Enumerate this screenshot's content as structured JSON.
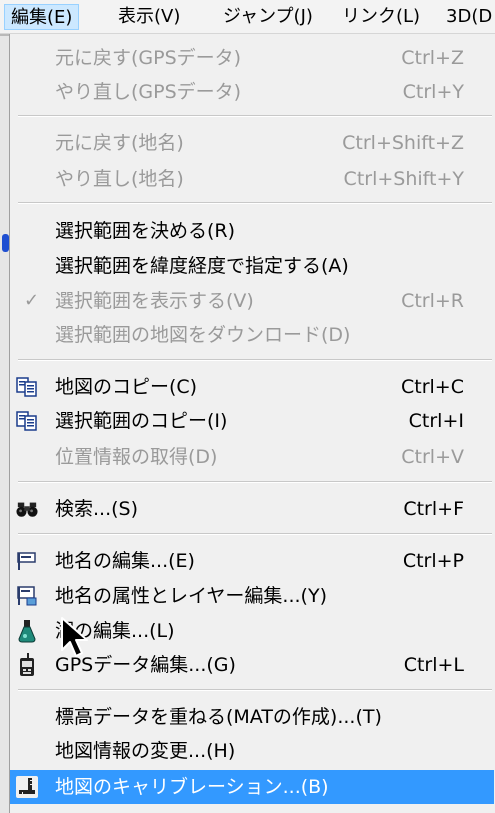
{
  "menubar": {
    "items": [
      "編集(E)",
      "表示(V)",
      "ジャンプ(J)",
      "リンク(L)",
      "3D(D"
    ]
  },
  "menu": {
    "undo_gps": {
      "label": "元に戻す(GPSデータ)",
      "shortcut": "Ctrl+Z"
    },
    "redo_gps": {
      "label": "やり直し(GPSデータ)",
      "shortcut": "Ctrl+Y"
    },
    "undo_place": {
      "label": "元に戻す(地名)",
      "shortcut": "Ctrl+Shift+Z"
    },
    "redo_place": {
      "label": "やり直し(地名)",
      "shortcut": "Ctrl+Shift+Y"
    },
    "select_range": {
      "label": "選択範囲を決める(R)"
    },
    "select_latlon": {
      "label": "選択範囲を緯度経度で指定する(A)"
    },
    "show_range": {
      "label": "選択範囲を表示する(V)",
      "shortcut": "Ctrl+R",
      "check": "✓"
    },
    "download_range": {
      "label": "選択範囲の地図をダウンロード(D)"
    },
    "copy_map": {
      "label": "地図のコピー(C)",
      "shortcut": "Ctrl+C"
    },
    "copy_range": {
      "label": "選択範囲のコピー(I)",
      "shortcut": "Ctrl+I"
    },
    "get_position": {
      "label": "位置情報の取得(D)",
      "shortcut": "Ctrl+V"
    },
    "search": {
      "label": "検索...(S)",
      "shortcut": "Ctrl+F"
    },
    "edit_place": {
      "label": "地名の編集...(E)",
      "shortcut": "Ctrl+P"
    },
    "edit_attr_layer": {
      "label": "地名の属性とレイヤー編集...(Y)"
    },
    "edit_water": {
      "label": "湖の編集...(L)"
    },
    "edit_gps": {
      "label": "GPSデータ編集...(G)",
      "shortcut": "Ctrl+L"
    },
    "overlay_elev": {
      "label": "標高データを重ねる(MATの作成)...(T)"
    },
    "change_map_info": {
      "label": "地図情報の変更...(H)"
    },
    "calibration": {
      "label": "地図のキャリブレーション...(B)"
    }
  },
  "colors": {
    "highlight": "#3399ff",
    "disabled_text": "#9a9a9a",
    "menu_bg": "#f0f0f0",
    "active_menu_bg": "#cce8ff"
  },
  "icons": {
    "copy_map": "copy-icon",
    "copy_range": "copy-icon",
    "search": "binoculars-icon",
    "edit_place": "flag-icon",
    "edit_attr_layer": "flag-layer-icon",
    "edit_water": "flask-icon",
    "edit_gps": "gps-device-icon",
    "calibration": "ruler-icon"
  }
}
